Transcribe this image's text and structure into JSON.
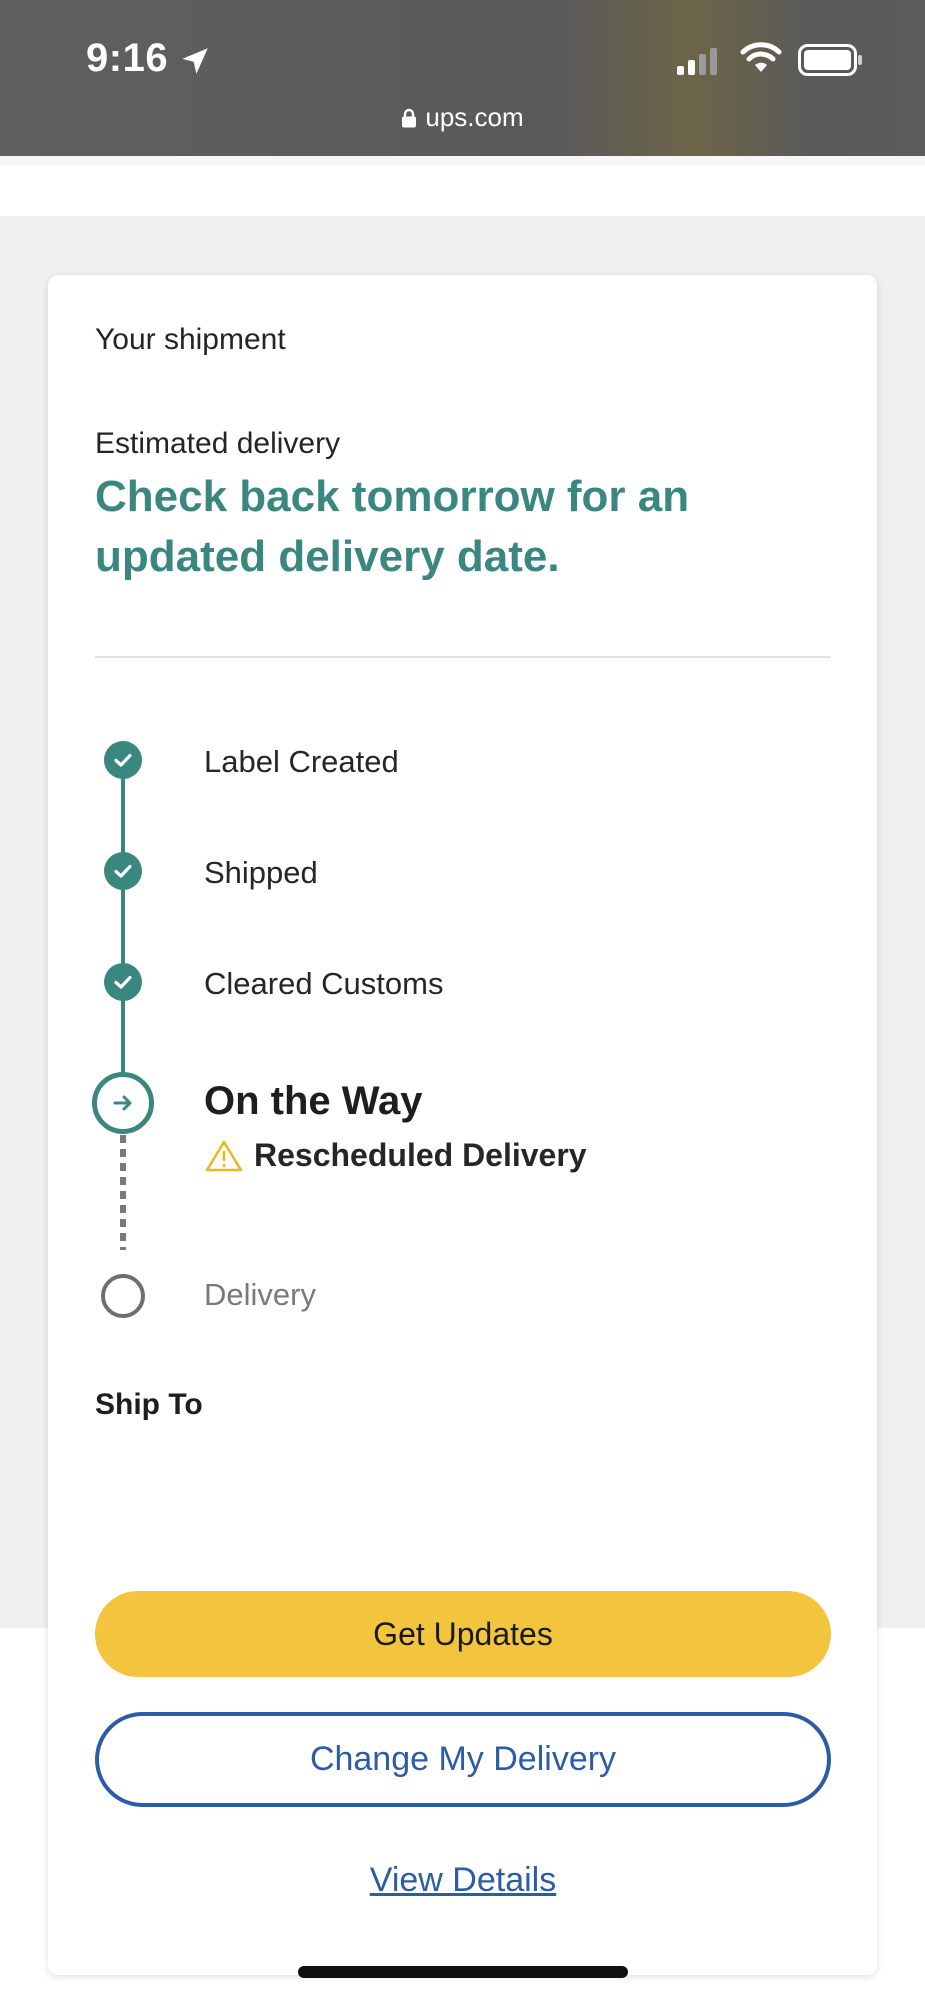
{
  "status_bar": {
    "time": "9:16",
    "url": "ups.com",
    "icons": [
      "location-arrow-icon",
      "signal-icon",
      "wifi-icon",
      "battery-icon",
      "lock-icon"
    ]
  },
  "colors": {
    "accent_green": "#3a877f",
    "button_yellow": "#f3c53f",
    "link_blue": "#2d5ca6",
    "warning_yellow": "#e8b923"
  },
  "shipment": {
    "title": "Your shipment",
    "estimated_label": "Estimated delivery",
    "estimated_value": "Check back tomorrow for an updated delivery date."
  },
  "progress": {
    "steps": [
      {
        "label": "Label Created",
        "state": "done"
      },
      {
        "label": "Shipped",
        "state": "done"
      },
      {
        "label": "Cleared Customs",
        "state": "done"
      },
      {
        "label": "On the Way",
        "state": "current"
      },
      {
        "label": "Delivery",
        "state": "pending"
      }
    ],
    "status_note": "Rescheduled Delivery"
  },
  "ship_to": {
    "label": "Ship To"
  },
  "actions": {
    "get_updates": "Get Updates",
    "change_delivery": "Change My Delivery",
    "view_details": "View Details"
  }
}
